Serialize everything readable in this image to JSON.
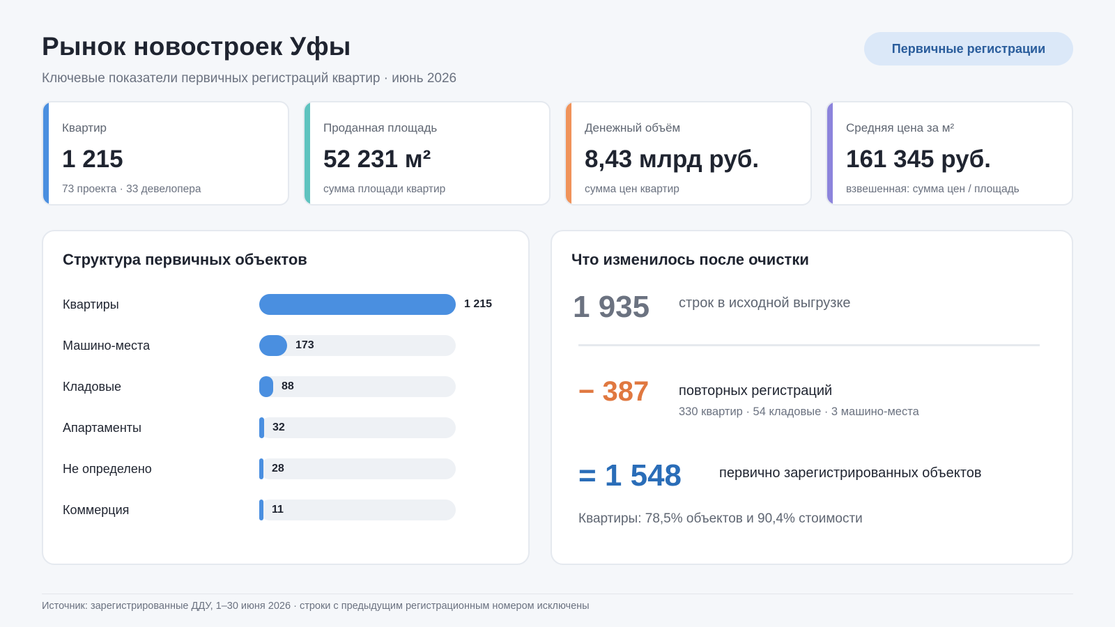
{
  "header": {
    "title": "Рынок новостроек Уфы",
    "subtitle": "Ключевые показатели первичных регистраций квартир · июнь 2026",
    "pill_label": "Первичные регистрации"
  },
  "kpis": [
    {
      "label": "Квартир",
      "value": "1 215",
      "note": "73 проекта · 33 девелопера",
      "color": "#4a8fe0"
    },
    {
      "label": "Проданная площадь",
      "value": "52 231 м²",
      "note": "сумма площади квартир",
      "color": "#5fc3bf"
    },
    {
      "label": "Денежный объём",
      "value": "8,43 млрд руб.",
      "note": "сумма цен квартир",
      "color": "#f0935a"
    },
    {
      "label": "Средняя цена за м²",
      "value": "161 345 руб.",
      "note": "взвешенная: сумма цен / площадь",
      "color": "#8c84dc"
    }
  ],
  "structure": {
    "title": "Структура первичных объектов",
    "items": [
      {
        "label": "Квартиры",
        "value": 1215,
        "display": "1 215"
      },
      {
        "label": "Машино-места",
        "value": 173,
        "display": "173"
      },
      {
        "label": "Кладовые",
        "value": 88,
        "display": "88"
      },
      {
        "label": "Апартаменты",
        "value": 32,
        "display": "32"
      },
      {
        "label": "Не определено",
        "value": 28,
        "display": "28"
      },
      {
        "label": "Коммерция",
        "value": 11,
        "display": "11"
      }
    ]
  },
  "cleaning": {
    "title": "Что изменилось после очистки",
    "raw_value": "1 935",
    "raw_desc": "строк в исходной выгрузке",
    "dup_value": "− 387",
    "dup_desc": "повторных регистраций",
    "dup_note": "330 квартир · 54 кладовые · 3 машино-места",
    "result_value": "= 1 548",
    "result_desc": "первично зарегистрированных объектов",
    "summary": "Квартиры: 78,5% объектов и 90,4% стоимости"
  },
  "footer": {
    "text": "Источник: зарегистрированные ДДУ, 1–30 июня 2026 · строки с предыдущим регистрационным номером исключены"
  }
}
